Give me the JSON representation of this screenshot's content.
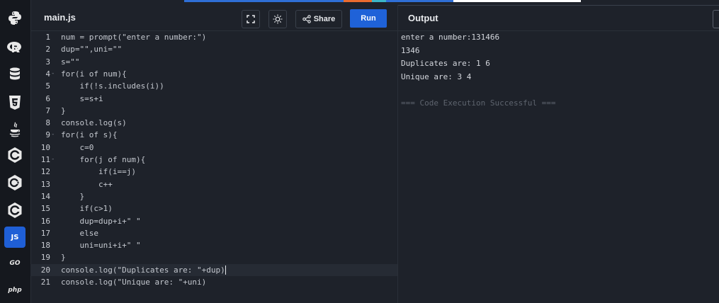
{
  "editor": {
    "file_tab": "main.js",
    "share_label": "Share",
    "run_label": "Run",
    "code_lines": [
      {
        "no": "1",
        "fold": "",
        "text": "num = prompt(\"enter a number:\")"
      },
      {
        "no": "2",
        "fold": "",
        "text": "dup=\"\",uni=\"\""
      },
      {
        "no": "3",
        "fold": "",
        "text": "s=\"\""
      },
      {
        "no": "4",
        "fold": "-",
        "text": "for(i of num){"
      },
      {
        "no": "5",
        "fold": "",
        "text": "    if(!s.includes(i))"
      },
      {
        "no": "6",
        "fold": "",
        "text": "    s=s+i"
      },
      {
        "no": "7",
        "fold": "",
        "text": "}"
      },
      {
        "no": "8",
        "fold": "",
        "text": "console.log(s)"
      },
      {
        "no": "9",
        "fold": "-",
        "text": "for(i of s){"
      },
      {
        "no": "10",
        "fold": "",
        "text": "    c=0"
      },
      {
        "no": "11",
        "fold": "-",
        "text": "    for(j of num){"
      },
      {
        "no": "12",
        "fold": "",
        "text": "        if(i==j)"
      },
      {
        "no": "13",
        "fold": "",
        "text": "        c++"
      },
      {
        "no": "14",
        "fold": "",
        "text": "    }"
      },
      {
        "no": "15",
        "fold": "",
        "text": "    if(c>1)"
      },
      {
        "no": "16",
        "fold": "",
        "text": "    dup=dup+i+\" \""
      },
      {
        "no": "17",
        "fold": "",
        "text": "    else"
      },
      {
        "no": "18",
        "fold": "",
        "text": "    uni=uni+i+\" \""
      },
      {
        "no": "19",
        "fold": "",
        "text": "}"
      },
      {
        "no": "20",
        "fold": "",
        "text": "console.log(\"Duplicates are: \"+dup)"
      },
      {
        "no": "21",
        "fold": "",
        "text": "console.log(\"Unique are: \"+uni)"
      }
    ]
  },
  "output": {
    "title": "Output",
    "lines": [
      "enter a number:131466",
      "1346",
      "Duplicates are: 1 6",
      "Unique are: 3 4",
      "",
      "=== Code Execution Successful ==="
    ]
  },
  "sidebar": {
    "items": [
      {
        "name": "python-icon",
        "label": ""
      },
      {
        "name": "r-icon",
        "label": ""
      },
      {
        "name": "sql-icon",
        "label": ""
      },
      {
        "name": "html5-icon",
        "label": ""
      },
      {
        "name": "java-icon",
        "label": ""
      },
      {
        "name": "c-icon",
        "label": ""
      },
      {
        "name": "cpp-icon",
        "label": ""
      },
      {
        "name": "csharp-icon",
        "label": ""
      },
      {
        "name": "javascript-icon",
        "label": "JS"
      },
      {
        "name": "go-icon",
        "label": "GO"
      },
      {
        "name": "php-icon",
        "label": "php"
      }
    ]
  },
  "colors": {
    "accent": "#1f62d8",
    "background": "#1e222a",
    "sidebar": "#15181e"
  }
}
